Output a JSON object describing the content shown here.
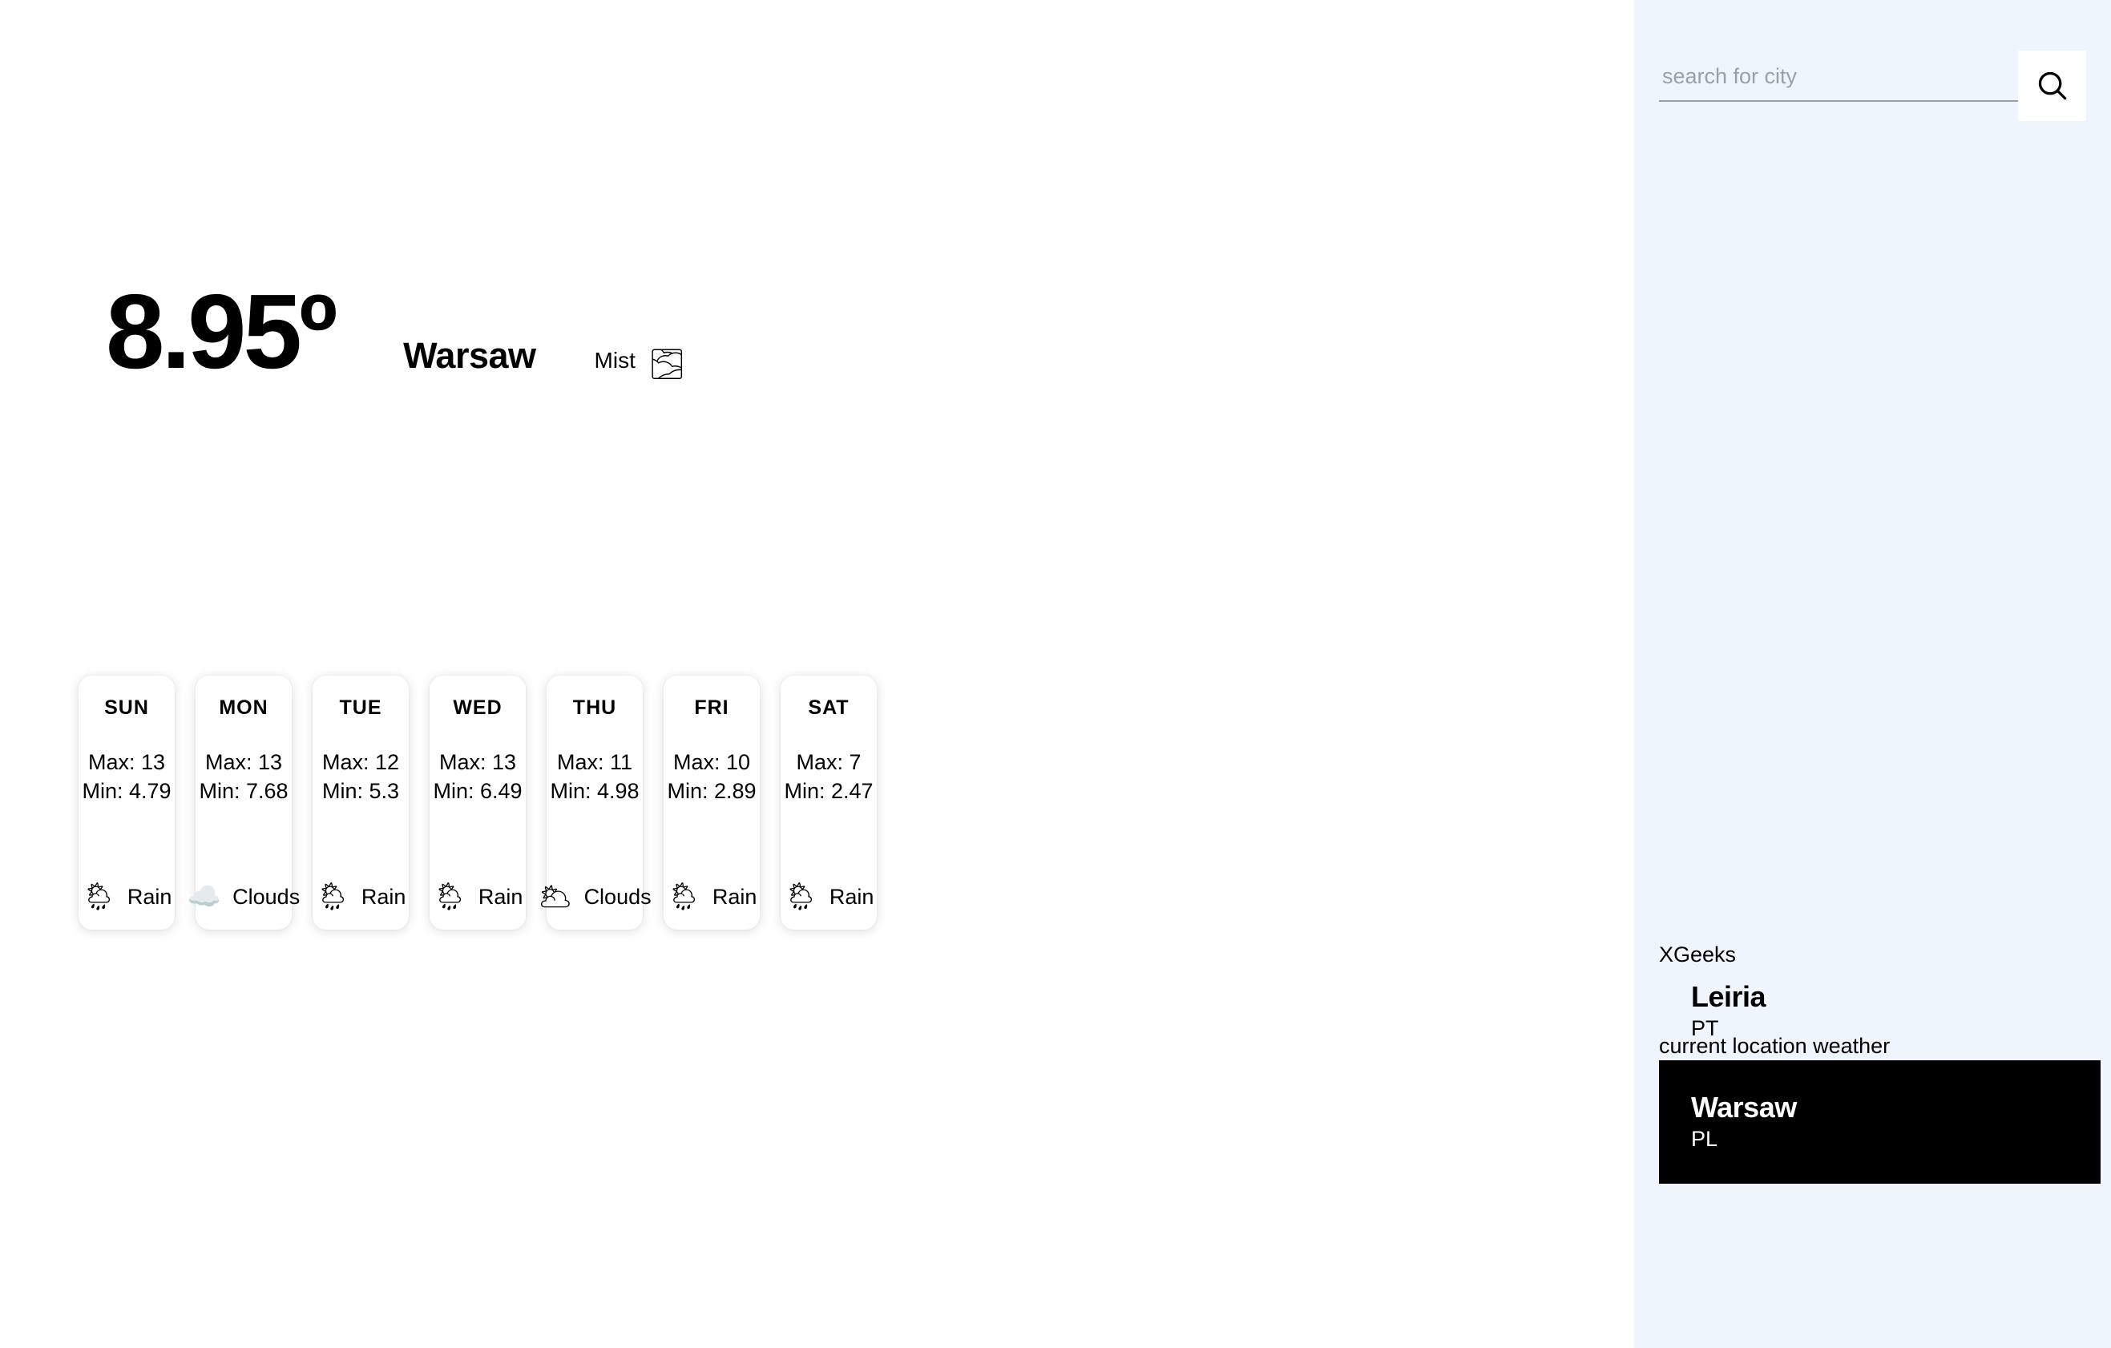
{
  "current": {
    "temperature": "8.95º",
    "city": "Warsaw",
    "description": "Mist",
    "description_icon": "🌫"
  },
  "forecast": {
    "days": [
      {
        "day": "SUN",
        "max_label": "Max: 13",
        "min_label": "Min: 4.79",
        "condition": "Rain",
        "icon": "🌦"
      },
      {
        "day": "MON",
        "max_label": "Max: 13",
        "min_label": "Min: 7.68",
        "condition": "Clouds",
        "icon": "☁️"
      },
      {
        "day": "TUE",
        "max_label": "Max: 12",
        "min_label": "Min: 5.3",
        "condition": "Rain",
        "icon": "🌦"
      },
      {
        "day": "WED",
        "max_label": "Max: 13",
        "min_label": "Min: 6.49",
        "condition": "Rain",
        "icon": "🌦"
      },
      {
        "day": "THU",
        "max_label": "Max: 11",
        "min_label": "Min: 4.98",
        "condition": "Clouds",
        "icon": "🌥"
      },
      {
        "day": "FRI",
        "max_label": "Max: 10",
        "min_label": "Min: 2.89",
        "condition": "Rain",
        "icon": "🌦"
      },
      {
        "day": "SAT",
        "max_label": "Max: 7",
        "min_label": "Min: 2.47",
        "condition": "Rain",
        "icon": "🌦"
      }
    ]
  },
  "sidebar": {
    "search": {
      "value": "",
      "placeholder": "search for city",
      "button_icon": "search-icon"
    },
    "xgeeks_label": "XGeeks",
    "current_location_label": "current location weather",
    "cities": [
      {
        "name": "Leiria",
        "country": "PT",
        "selected": false
      },
      {
        "name": "Warsaw",
        "country": "PL",
        "selected": true
      }
    ]
  },
  "colors": {
    "sidebar_background": "#eff5fd",
    "main_background": "#ffffff",
    "selected_city_background": "#000000",
    "text_primary": "#000000",
    "placeholder": "#9aa0a6"
  }
}
